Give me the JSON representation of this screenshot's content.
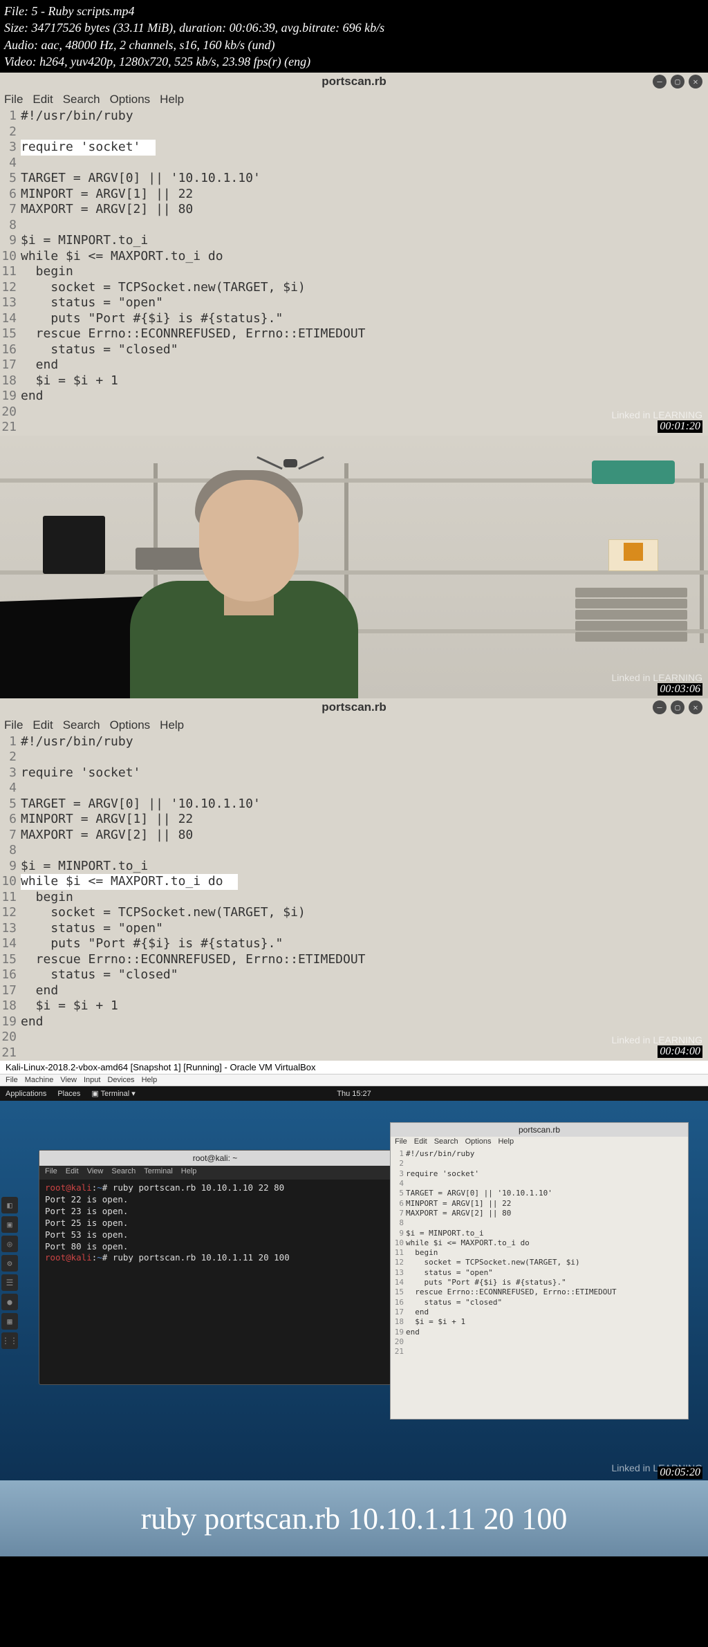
{
  "file_info": {
    "line1": "File: 5 - Ruby scripts.mp4",
    "line2": "Size: 34717526 bytes (33.11 MiB), duration: 00:06:39, avg.bitrate: 696 kb/s",
    "line3": "Audio: aac, 48000 Hz, 2 channels, s16, 160 kb/s (und)",
    "line4": "Video: h264, yuv420p, 1280x720, 525 kb/s, 23.98 fps(r) (eng)"
  },
  "editor": {
    "title": "portscan.rb",
    "menu": [
      "File",
      "Edit",
      "Search",
      "Options",
      "Help"
    ],
    "code": [
      "#!/usr/bin/ruby",
      "",
      "require 'socket'",
      "",
      "TARGET = ARGV[0] || '10.10.1.10'",
      "MINPORT = ARGV[1] || 22",
      "MAXPORT = ARGV[2] || 80",
      "",
      "$i = MINPORT.to_i",
      "while $i <= MAXPORT.to_i do",
      "  begin",
      "    socket = TCPSocket.new(TARGET, $i)",
      "    status = \"open\"",
      "    puts \"Port #{$i} is #{status}.\"",
      "  rescue Errno::ECONNREFUSED, Errno::ETIMEDOUT",
      "    status = \"closed\"",
      "  end",
      "  $i = $i + 1",
      "end",
      "",
      ""
    ]
  },
  "panel1": {
    "highlight_line": 3,
    "timestamp": "00:01:20"
  },
  "panel2": {
    "timestamp": "00:03:06"
  },
  "panel3": {
    "highlight_line": 10,
    "timestamp": "00:04:00"
  },
  "panel4": {
    "timestamp": "00:05:20",
    "vbox_title": "Kali-Linux-2018.2-vbox-amd64 [Snapshot 1] [Running] - Oracle VM VirtualBox",
    "vbox_menu": [
      "File",
      "Machine",
      "View",
      "Input",
      "Devices",
      "Help"
    ],
    "kali_topbar": {
      "apps": "Applications",
      "places": "Places",
      "term": "Terminal",
      "time": "Thu 15:27"
    },
    "terminal": {
      "title": "root@kali: ~",
      "menu": [
        "File",
        "Edit",
        "View",
        "Search",
        "Terminal",
        "Help"
      ],
      "lines": [
        {
          "prompt": "root@kali",
          "path": "~",
          "cmd": "ruby portscan.rb 10.10.1.10 22 80"
        },
        {
          "out": "Port 22 is open."
        },
        {
          "out": "Port 23 is open."
        },
        {
          "out": "Port 25 is open."
        },
        {
          "out": "Port 53 is open."
        },
        {
          "out": "Port 80 is open."
        },
        {
          "prompt": "root@kali",
          "path": "~",
          "cmd": "ruby portscan.rb 10.10.1.11 20 100"
        }
      ]
    },
    "small_editor_title": "portscan.rb",
    "banner": "ruby portscan.rb 10.10.1.11 20 100"
  },
  "watermark": "Linked in LEARNING"
}
